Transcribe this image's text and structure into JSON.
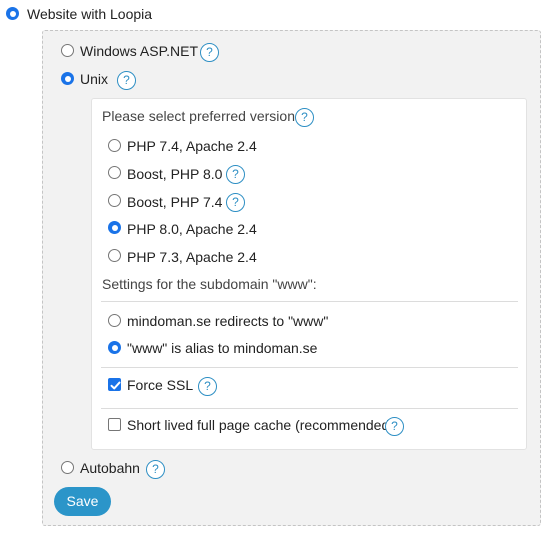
{
  "top_option": {
    "label": "Website with Loopia",
    "checked": true
  },
  "platform": {
    "windows": {
      "label": "Windows ASP.NET",
      "help": "?"
    },
    "unix": {
      "label": "Unix",
      "help": "?"
    },
    "autobahn": {
      "label": "Autobahn",
      "help": "?"
    }
  },
  "version": {
    "prompt": "Please select preferred version:",
    "help": "?",
    "options": [
      {
        "label": "PHP 7.4, Apache 2.4",
        "help": ""
      },
      {
        "label": "Boost, PHP 8.0",
        "help": "?"
      },
      {
        "label": "Boost, PHP 7.4",
        "help": "?"
      },
      {
        "label": "PHP 8.0, Apache 2.4",
        "help": ""
      },
      {
        "label": "PHP 7.3, Apache 2.4",
        "help": ""
      }
    ],
    "selected": "PHP 8.0, Apache 2.4"
  },
  "subdomain": {
    "heading": "Settings for the subdomain \"www\":",
    "options": [
      {
        "label": "mindoman.se redirects to \"www\""
      },
      {
        "label": "\"www\" is alias to mindoman.se"
      }
    ],
    "selected": "\"www\" is alias to mindoman.se"
  },
  "force_ssl": {
    "label": "Force SSL",
    "help": "?",
    "checked": true
  },
  "cache": {
    "label": "Short lived full page cache (recommended)",
    "help": "?",
    "checked": false
  },
  "save_button": {
    "label": "Save"
  },
  "colors": {
    "accent": "#1a73e8",
    "help_blue": "#2e8fc4",
    "button_blue": "#2b95c9",
    "panel_bg": "#f2f2f2"
  }
}
